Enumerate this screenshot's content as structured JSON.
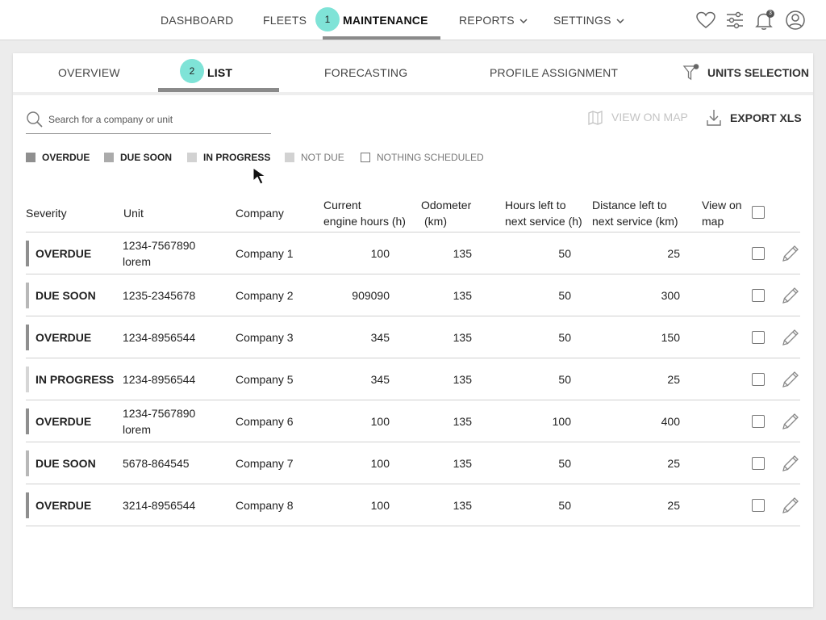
{
  "nav": {
    "items": [
      {
        "label": "DASHBOARD"
      },
      {
        "label": "FLEETS"
      },
      {
        "label": "MAINTENANCE",
        "active": true
      },
      {
        "label": "REPORTS",
        "dropdown": true
      },
      {
        "label": "SETTINGS",
        "dropdown": true
      }
    ],
    "step_badge": "1",
    "notification_count": "3",
    "icons": [
      "heart-icon",
      "sliders-icon",
      "bell-icon",
      "user-icon"
    ]
  },
  "subtabs": {
    "items": [
      {
        "label": "OVERVIEW"
      },
      {
        "label": "LIST",
        "active": true
      },
      {
        "label": "FORECASTING"
      },
      {
        "label": "PROFILE ASSIGNMENT"
      }
    ],
    "step_badge": "2",
    "units_selection": "UNITS SELECTION"
  },
  "toolbar": {
    "search_placeholder": "Search for a company or unit",
    "view_on_map": "VIEW ON MAP",
    "export": "EXPORT XLS"
  },
  "legend": [
    {
      "label": "OVERDUE",
      "color": "#8f8f8f",
      "filled": true,
      "bold": true
    },
    {
      "label": "DUE SOON",
      "color": "#ababab",
      "filled": true,
      "bold": true
    },
    {
      "label": "IN PROGRESS",
      "color": "#d2d2d2",
      "filled": true,
      "bold": true
    },
    {
      "label": "NOT DUE",
      "color": "#d2d2d2",
      "filled": true,
      "bold": false
    },
    {
      "label": "NOTHING SCHEDULED",
      "color": "#ffffff",
      "filled": false,
      "bold": false
    }
  ],
  "table": {
    "headers": {
      "severity": "Severity",
      "unit": "Unit",
      "company": "Company",
      "engine_hours_1": "Current",
      "engine_hours_2": "engine hours (h)",
      "odometer_1": "Odometer",
      "odometer_2": "(km)",
      "hours_left_1": "Hours left to",
      "hours_left_2": "next service (h)",
      "distance_left_1": "Distance left to",
      "distance_left_2": "next service (km)",
      "view_on_map_1": "View on",
      "view_on_map_2": "map"
    },
    "rows": [
      {
        "severity": "OVERDUE",
        "unit": "1234-7567890 lorem",
        "company": "Company 1",
        "engine_hours": "100",
        "odometer": "135",
        "hours_left": "50",
        "distance_left": "25"
      },
      {
        "severity": "DUE SOON",
        "unit": "1235-2345678",
        "company": "Company 2",
        "engine_hours": "909090",
        "odometer": "135",
        "hours_left": "50",
        "distance_left": "300"
      },
      {
        "severity": "OVERDUE",
        "unit": "1234-8956544",
        "company": "Company 3",
        "engine_hours": "345",
        "odometer": "135",
        "hours_left": "50",
        "distance_left": "150"
      },
      {
        "severity": "IN PROGRESS",
        "unit": "1234-8956544",
        "company": "Company 5",
        "engine_hours": "345",
        "odometer": "135",
        "hours_left": "50",
        "distance_left": "25"
      },
      {
        "severity": "OVERDUE",
        "unit": "1234-7567890 lorem",
        "company": "Company 6",
        "engine_hours": "100",
        "odometer": "135",
        "hours_left": "100",
        "distance_left": "400"
      },
      {
        "severity": "DUE SOON",
        "unit": "5678-864545",
        "company": "Company 7",
        "engine_hours": "100",
        "odometer": "135",
        "hours_left": "50",
        "distance_left": "25"
      },
      {
        "severity": "OVERDUE",
        "unit": "3214-8956544",
        "company": "Company 8",
        "engine_hours": "100",
        "odometer": "135",
        "hours_left": "50",
        "distance_left": "25"
      }
    ]
  },
  "severity_colors": {
    "OVERDUE": "#8f8f8f",
    "DUE SOON": "#b8b8b8",
    "IN PROGRESS": "#d6d6d6"
  },
  "accent_color": "#7fe3d7"
}
